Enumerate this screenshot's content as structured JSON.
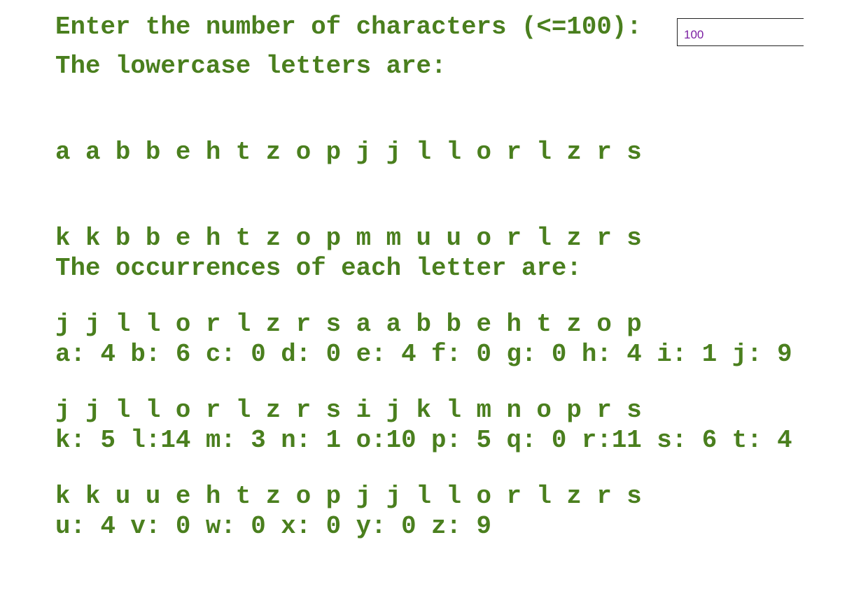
{
  "prompt": {
    "label": "Enter the number of characters (<=100):",
    "input_value": "100"
  },
  "letters": {
    "heading": "The lowercase letters are:",
    "rows": [
      "a a b b e h t z o p j j l l o r l z r s",
      "k k b b e h t z o p m m u u o r l z r s",
      "j j l l o r l z r s a a b b e h t z o p",
      "j j l l o r l z r s i j k l m n o p r s",
      "k k u u e h t z o p j j l l o r l z r s"
    ]
  },
  "occurrences": {
    "heading": "The occurrences of each letter are:",
    "rows": [
      "a: 4 b: 6 c: 0 d: 0 e: 4 f: 0 g: 0 h: 4 i: 1 j: 9",
      "k: 5 l:14 m: 3 n: 1 o:10 p: 5 q: 0 r:11 s: 6 t: 4",
      "u: 4 v: 0 w: 0 x: 0 y: 0 z: 9"
    ]
  },
  "colors": {
    "text": "#4a7f1e",
    "input_text": "#7b1fa2"
  }
}
